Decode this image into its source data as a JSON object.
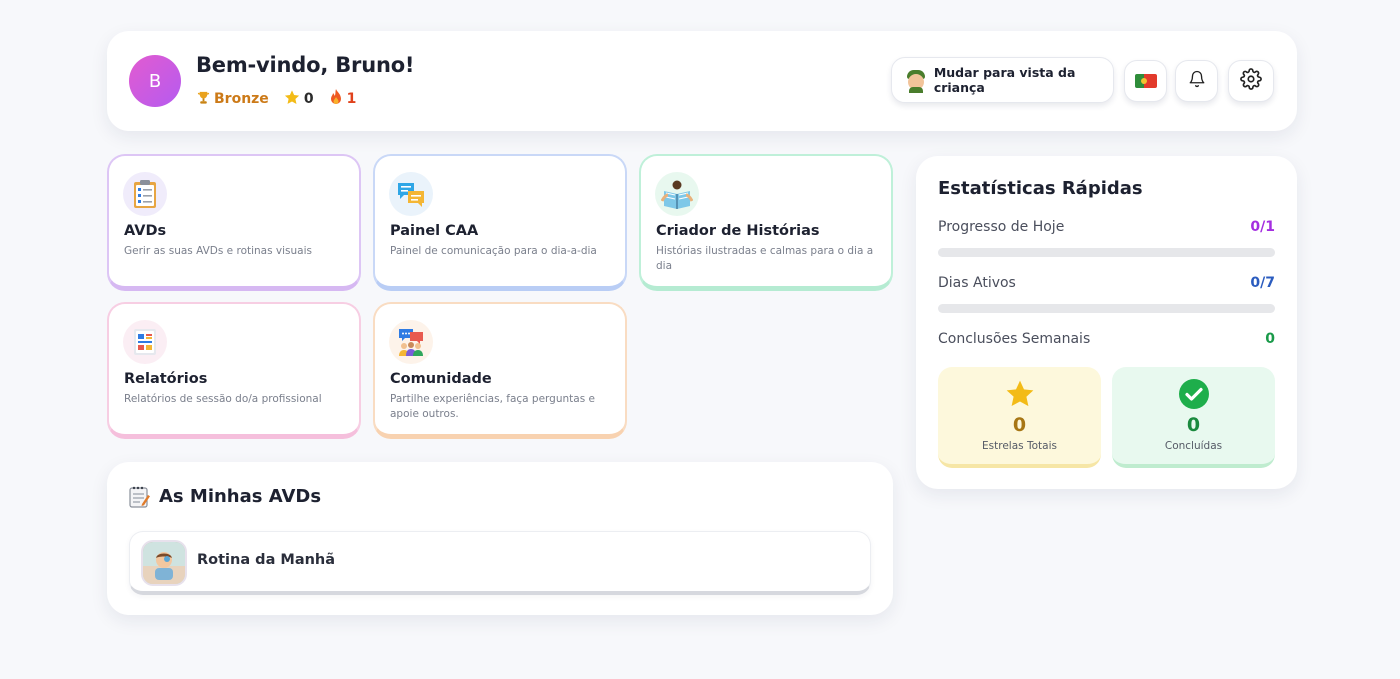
{
  "header": {
    "avatar_initial": "B",
    "welcome": "Bem-vindo, Bruno!",
    "rank": "Bronze",
    "stars": "0",
    "streak": "1",
    "switch_label": "Mudar para vista da criança"
  },
  "cards": [
    {
      "title": "AVDs",
      "desc": "Gerir as suas AVDs e rotinas visuais",
      "color": "#d6b8f2"
    },
    {
      "title": "Painel CAA",
      "desc": "Painel de comunicação para o dia-a-dia",
      "color": "#b9cdf5"
    },
    {
      "title": "Criador de Histórias",
      "desc": "Histórias ilustradas e calmas para o dia a dia",
      "color": "#b5ebd2"
    },
    {
      "title": "Relatórios",
      "desc": "Relatórios de sessão do/a profissional",
      "color": "#f5bfdc"
    },
    {
      "title": "Comunidade",
      "desc": "Partilhe experiências, faça perguntas e apoie outros.",
      "color": "#f8d2b0"
    }
  ],
  "avds": {
    "title": "As Minhas AVDs",
    "items": [
      {
        "label": "Rotina da Manhã"
      }
    ]
  },
  "stats": {
    "title": "Estatísticas Rápidas",
    "today_label": "Progresso de Hoje",
    "today_value": "0/1",
    "today_progress": 0,
    "active_label": "Dias Ativos",
    "active_value": "0/7",
    "active_progress": 0,
    "weekly_label": "Conclusões Semanais",
    "weekly_value": "0",
    "stars_total": "0",
    "stars_label": "Estrelas Totais",
    "completed": "0",
    "completed_label": "Concluídas"
  },
  "colors": {
    "purple": "#a42ee0",
    "blue": "#2b5cbf",
    "green": "#1a9a4a",
    "star": "#f3bb17",
    "check": "#1eae4b"
  }
}
